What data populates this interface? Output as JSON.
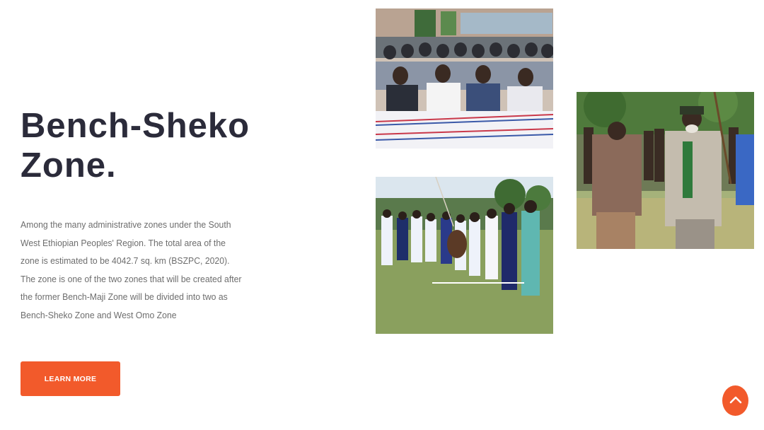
{
  "hero": {
    "title_line1": "Bench-Sheko",
    "title_line2": "Zone.",
    "description": "Among the many administrative zones under the South West Ethiopian Peoples' Region. The total area of the zone is estimated to be 4042.7 sq. km (BSZPC, 2020). The zone is one of the two zones that will be created after the former Bench-Maji Zone will be divided into two as Bench-Sheko Zone and West Omo Zone",
    "button_label": "LEARN MORE"
  },
  "gallery": {
    "photos": [
      "conference-audience-photo",
      "traditional-dance-photo",
      "village-elders-photo"
    ]
  },
  "colors": {
    "accent": "#f25a2b",
    "title": "#2b2b3a",
    "body_text": "#6d6d6d",
    "background": "#ffffff"
  },
  "icons": {
    "scroll_top": "chevron-up-icon"
  }
}
